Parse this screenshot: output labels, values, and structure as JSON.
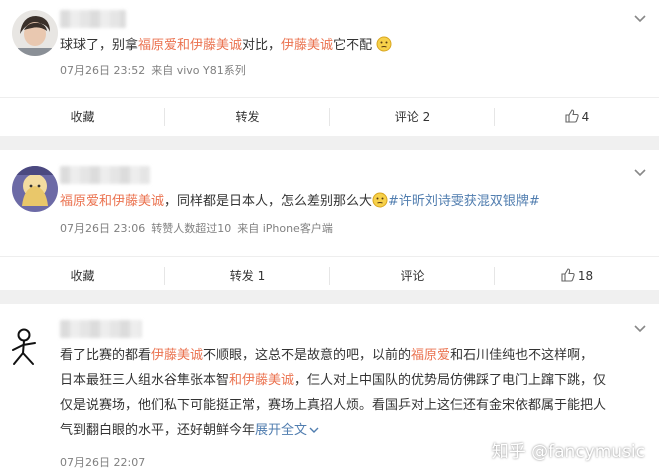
{
  "posts": [
    {
      "text_parts": [
        {
          "t": "球球了，别拿",
          "c": "plain"
        },
        {
          "t": "福原爱和伊藤美诚",
          "c": "hl"
        },
        {
          "t": "对比，",
          "c": "plain"
        },
        {
          "t": "伊藤美诚",
          "c": "hl"
        },
        {
          "t": "它不配",
          "c": "plain"
        }
      ],
      "time": "07月26日 23:52",
      "source": "来自 vivo Y81系列",
      "actions": {
        "favorite": "收藏",
        "repost": "转发",
        "comment": "评论 2",
        "like": "4"
      }
    },
    {
      "text_parts": [
        {
          "t": "福原爱和伊藤美诚",
          "c": "hl"
        },
        {
          "t": "，同样都是日本人，怎么差别那么大",
          "c": "plain"
        },
        {
          "t": "#许昕刘诗雯获混双银牌#",
          "c": "topic"
        }
      ],
      "time": "07月26日 23:06",
      "reposts_note": "转赞人数超过10",
      "source": "来自 iPhone客户端",
      "actions": {
        "favorite": "收藏",
        "repost": "转发 1",
        "comment": "评论",
        "like": "18"
      }
    },
    {
      "lines": [
        [
          {
            "t": "看了比赛的都看",
            "c": "plain"
          },
          {
            "t": "伊藤美诚",
            "c": "hl"
          },
          {
            "t": "不顺眼，这总不是故意的吧，以前的",
            "c": "plain"
          },
          {
            "t": "福原爱",
            "c": "hl"
          },
          {
            "t": "和石川佳纯也不这样啊，",
            "c": "plain"
          }
        ],
        [
          {
            "t": "日本最狂三人组水谷隼张本智",
            "c": "plain"
          },
          {
            "t": "和伊藤美诚",
            "c": "hl"
          },
          {
            "t": "，仨人对上中国队的优势局仿佛踩了电门上蹿下跳，仅",
            "c": "plain"
          }
        ],
        [
          {
            "t": "仅是说赛场，他们私下可能挺正常，赛场上真招人烦。看国乒对上这仨还有金宋依都属于能把人",
            "c": "plain"
          }
        ],
        [
          {
            "t": "气到翻白眼的水平，还好朝鲜今年",
            "c": "plain"
          }
        ]
      ],
      "expand": "展开全文",
      "time": "07月26日 22:07"
    }
  ],
  "watermark": "知乎 @fancymusic",
  "colors": {
    "highlight": "#eb7350",
    "topic": "#507daf",
    "meta": "#808080"
  }
}
